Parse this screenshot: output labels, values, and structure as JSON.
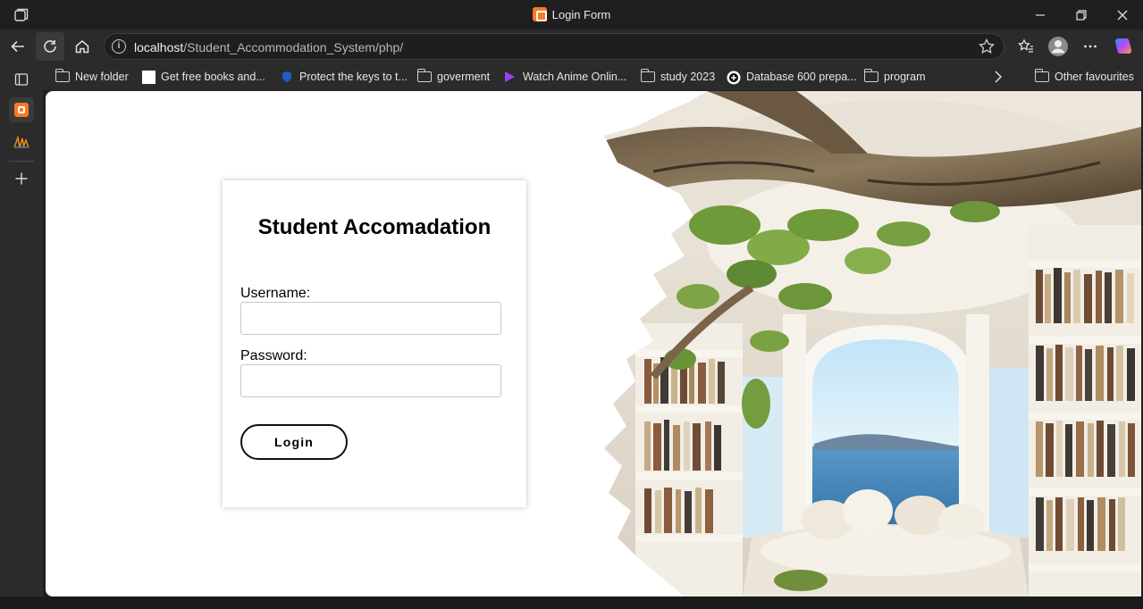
{
  "window": {
    "title": "Login Form",
    "minimize_icon": "minimize-icon",
    "restore_icon": "restore-icon",
    "close_icon": "close-icon"
  },
  "nav": {
    "url_host": "localhost",
    "url_path": "/Student_Accommodation_System/php/"
  },
  "favorites": [
    {
      "label": "New folder",
      "icon": "folder-icon"
    },
    {
      "label": "Get free books and...",
      "icon": "page-icon"
    },
    {
      "label": "Protect the keys to t...",
      "icon": "shield-icon"
    },
    {
      "label": "goverment",
      "icon": "folder-icon"
    },
    {
      "label": "Watch Anime Onlin...",
      "icon": "play-icon"
    },
    {
      "label": "study 2023",
      "icon": "folder-icon"
    },
    {
      "label": "Database 600 prepa...",
      "icon": "site-icon"
    },
    {
      "label": "program",
      "icon": "folder-icon"
    },
    {
      "label": "Other favourites",
      "icon": "folder-icon"
    }
  ],
  "login": {
    "heading": "Student Accomadation",
    "username_label": "Username:",
    "username_value": "",
    "password_label": "Password:",
    "password_value": "",
    "button_label": "Login"
  },
  "colors": {
    "xampp_orange": "#fb7a24",
    "chrome_dark": "#2b2b2b"
  }
}
